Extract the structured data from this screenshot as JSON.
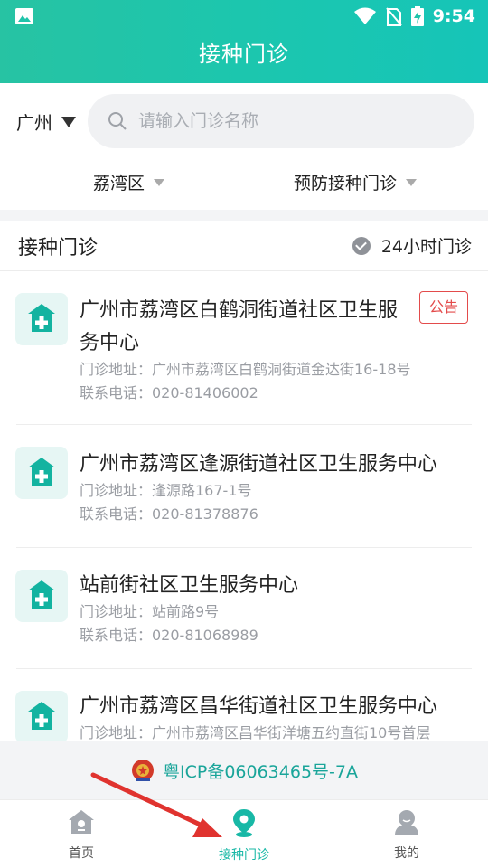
{
  "status_bar": {
    "time": "9:54"
  },
  "header": {
    "title": "接种门诊"
  },
  "search": {
    "city": "广州",
    "placeholder": "请输入门诊名称"
  },
  "filters": {
    "district": "荔湾区",
    "type": "预防接种门诊"
  },
  "list": {
    "title": "接种门诊",
    "hours_label": "24小时门诊",
    "items": [
      {
        "name": "广州市荔湾区白鹤洞街道社区卫生服务中心",
        "address": "门诊地址：广州市荔湾区白鹤洞街道金达街16-18号",
        "phone": "联系电话：020-81406002",
        "badge": "公告"
      },
      {
        "name": "广州市荔湾区逢源街道社区卫生服务中心",
        "address": "门诊地址：逢源路167-1号",
        "phone": "联系电话：020-81378876"
      },
      {
        "name": "站前街社区卫生服务中心",
        "address": "门诊地址：站前路9号",
        "phone": "联系电话：020-81068989"
      },
      {
        "name": "广州市荔湾区昌华街道社区卫生服务中心",
        "address": "门诊地址：广州市荔湾区昌华街洋塘五约直街10号首层"
      }
    ]
  },
  "icp": {
    "text": "粤ICP备06063465号-7A"
  },
  "tabs": [
    {
      "label": "首页",
      "icon": "home-icon"
    },
    {
      "label": "接种门诊",
      "icon": "location-pin-icon",
      "active": true
    },
    {
      "label": "我的",
      "icon": "user-icon"
    }
  ],
  "colors": {
    "accent": "#1cc6ae",
    "badge": "#e34b4b",
    "icp": "#1aa59a"
  }
}
